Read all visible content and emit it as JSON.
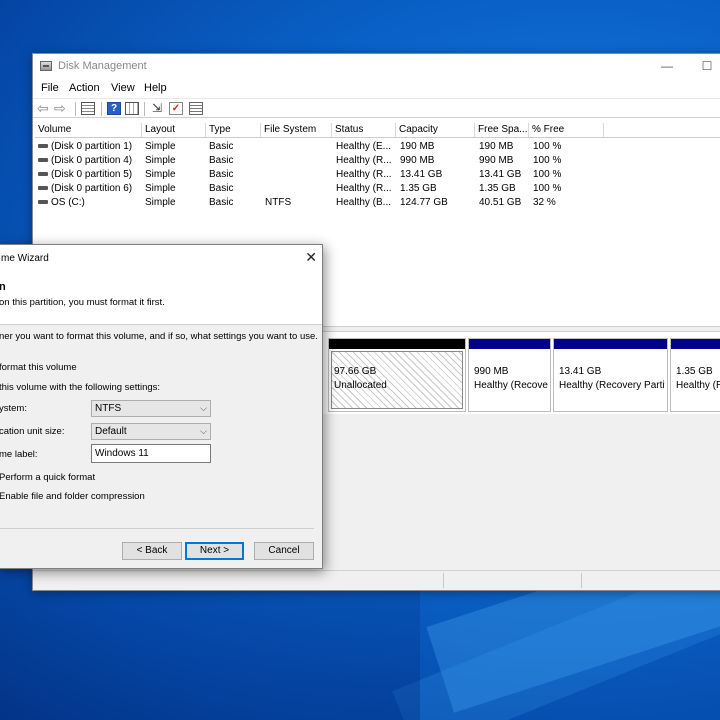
{
  "window": {
    "title": "Disk Management",
    "minimize_glyph": "—",
    "maximize_glyph": "☐"
  },
  "menu": [
    "File",
    "Action",
    "View",
    "Help"
  ],
  "toolbar": {
    "icons": [
      "back-arrow-icon",
      "forward-arrow-icon",
      "properties-icon",
      "help-icon",
      "view-icon",
      "connect-icon",
      "check-icon",
      "list-icon"
    ],
    "help_glyph": "?",
    "check_glyph": "✓",
    "connect_glyph": "⇲",
    "back_glyph": "⇦",
    "forward_glyph": "⇨"
  },
  "volume_list": {
    "columns": [
      "Volume",
      "Layout",
      "Type",
      "File System",
      "Status",
      "Capacity",
      "Free Spa...",
      "% Free"
    ],
    "rows": [
      {
        "volume": "(Disk 0 partition 1)",
        "layout": "Simple",
        "type": "Basic",
        "fs": "",
        "status": "Healthy (E...",
        "capacity": "190 MB",
        "free": "190 MB",
        "pct": "100 %"
      },
      {
        "volume": "(Disk 0 partition 4)",
        "layout": "Simple",
        "type": "Basic",
        "fs": "",
        "status": "Healthy (R...",
        "capacity": "990 MB",
        "free": "990 MB",
        "pct": "100 %"
      },
      {
        "volume": "(Disk 0 partition 5)",
        "layout": "Simple",
        "type": "Basic",
        "fs": "",
        "status": "Healthy (R...",
        "capacity": "13.41 GB",
        "free": "13.41 GB",
        "pct": "100 %"
      },
      {
        "volume": "(Disk 0 partition 6)",
        "layout": "Simple",
        "type": "Basic",
        "fs": "",
        "status": "Healthy (R...",
        "capacity": "1.35 GB",
        "free": "1.35 GB",
        "pct": "100 %"
      },
      {
        "volume": "OS (C:)",
        "layout": "Simple",
        "type": "Basic",
        "fs": "NTFS",
        "status": "Healthy (B...",
        "capacity": "124.77 GB",
        "free": "40.51 GB",
        "pct": "32 %"
      }
    ]
  },
  "disk_map": {
    "partitions": [
      {
        "size": "97.66 GB",
        "status": "Unallocated",
        "kind": "unallocated"
      },
      {
        "size": "990 MB",
        "status": "Healthy (Recove",
        "kind": "primary"
      },
      {
        "size": "13.41 GB",
        "status": "Healthy (Recovery Partit",
        "kind": "primary"
      },
      {
        "size": "1.35 GB",
        "status": "Healthy (R",
        "kind": "primary"
      }
    ]
  },
  "wizard": {
    "title": "me Wizard",
    "close_glyph": "✕",
    "header_title": "n",
    "header_subtitle": "on this partition, you must format it first.",
    "intro": "ner you want to format this volume, and if so, what settings you want to use.",
    "option_dont_format": "format this volume",
    "option_format_with": "this volume with the following settings:",
    "file_system_label": "ystem:",
    "file_system_value": "NTFS",
    "alloc_unit_label": "cation unit size:",
    "alloc_unit_value": "Default",
    "volume_label_label": "me label:",
    "volume_label_value": "Windows 11",
    "quick_format": "Perform a quick format",
    "compression": "Enable file and folder compression",
    "back_button": "< Back",
    "next_button": "Next >",
    "cancel_button": "Cancel",
    "chevron_glyph": "⌵"
  },
  "colors": {
    "primary_partition_bar": "#00008b",
    "unallocated_bar": "#000000",
    "default_button_border": "#0078d7"
  }
}
